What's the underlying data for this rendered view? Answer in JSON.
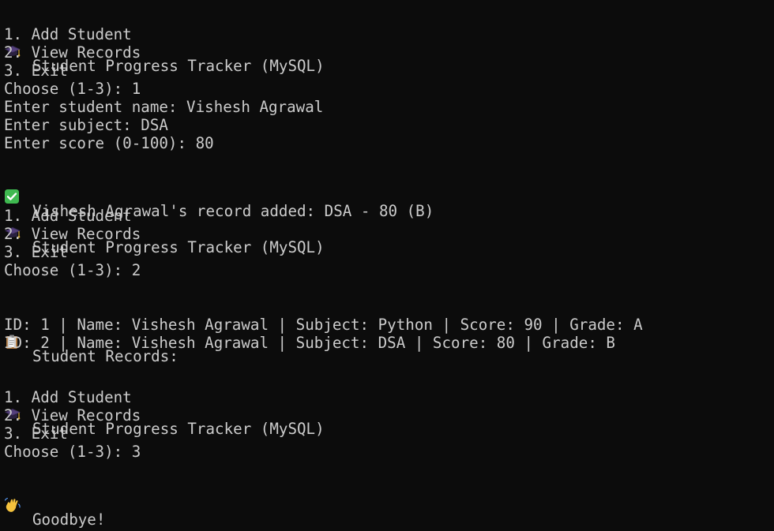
{
  "lines": [
    {
      "kind": "text",
      "icon": "graduation-cap-icon",
      "text": "Student Progress Tracker (MySQL)"
    },
    {
      "kind": "text",
      "text": "1. Add Student"
    },
    {
      "kind": "text",
      "text": "2. View Records"
    },
    {
      "kind": "text",
      "text": "3. Exit"
    },
    {
      "kind": "text",
      "text": "Choose (1-3): 1"
    },
    {
      "kind": "text",
      "text": "Enter student name: Vishesh Agrawal"
    },
    {
      "kind": "text",
      "text": "Enter subject: DSA"
    },
    {
      "kind": "text",
      "text": "Enter score (0-100): 80"
    },
    {
      "kind": "text",
      "icon": "check-mark-icon",
      "text": "Vishesh Agrawal's record added: DSA - 80 (B)"
    },
    {
      "kind": "blank",
      "text": ""
    },
    {
      "kind": "text",
      "icon": "graduation-cap-icon",
      "text": "Student Progress Tracker (MySQL)"
    },
    {
      "kind": "text",
      "text": "1. Add Student"
    },
    {
      "kind": "text",
      "text": "2. View Records"
    },
    {
      "kind": "text",
      "text": "3. Exit"
    },
    {
      "kind": "text",
      "text": "Choose (1-3): 2"
    },
    {
      "kind": "blank",
      "text": ""
    },
    {
      "kind": "text",
      "icon": "clipboard-icon",
      "text": "Student Records:"
    },
    {
      "kind": "text",
      "text": "ID: 1 | Name: Vishesh Agrawal | Subject: Python | Score: 90 | Grade: A"
    },
    {
      "kind": "text",
      "text": "ID: 2 | Name: Vishesh Agrawal | Subject: DSA | Score: 80 | Grade: B"
    },
    {
      "kind": "blank",
      "text": ""
    },
    {
      "kind": "text",
      "icon": "graduation-cap-icon",
      "text": "Student Progress Tracker (MySQL)"
    },
    {
      "kind": "text",
      "text": "1. Add Student"
    },
    {
      "kind": "text",
      "text": "2. View Records"
    },
    {
      "kind": "text",
      "text": "3. Exit"
    },
    {
      "kind": "text",
      "text": "Choose (1-3): 3"
    },
    {
      "kind": "text",
      "icon": "waving-hand-icon",
      "text": "Goodbye!"
    }
  ],
  "colors": {
    "background": "#0c0c0c",
    "foreground": "#cccccc",
    "check_green": "#3fb950"
  }
}
